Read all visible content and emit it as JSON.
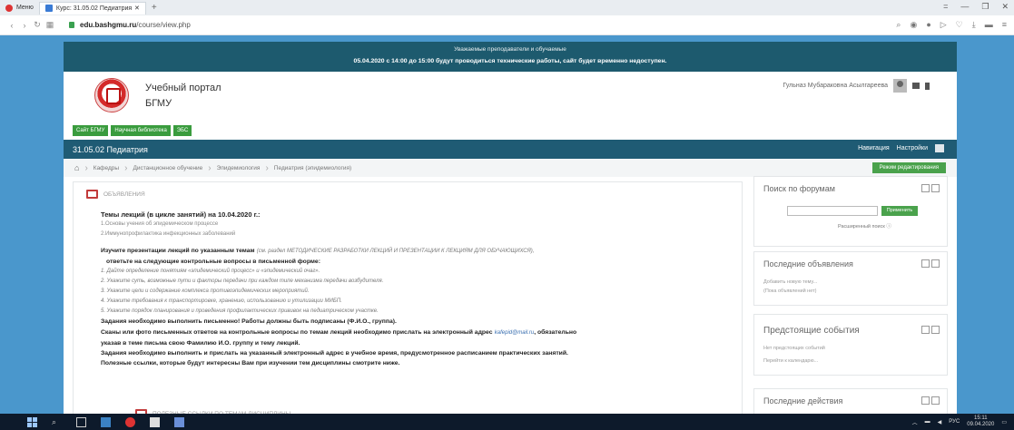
{
  "browser": {
    "tabs": [
      {
        "label": "Меню"
      },
      {
        "label": "Курс: 31.05.02 Педиатрия"
      }
    ],
    "new_tab": "+",
    "url_domain": "edu.bashgmu.ru",
    "url_path": "/course/view.php",
    "window_controls": [
      "=",
      "—",
      "❐",
      "✕"
    ]
  },
  "notice": {
    "line1": "Уважаемые преподаватели и обучаемые",
    "line2": "05.04.2020 с 14:00 до 15:00 будут проводиться технические работы, сайт будет временно недоступен."
  },
  "brand": {
    "title_line1": "Учебный портал",
    "title_line2": "БГМУ"
  },
  "user": {
    "name": "Гульназ Мубараковна Асылгареева"
  },
  "quick_links": [
    "Сайт БГМУ",
    "Научная библиотека",
    "ЭБС"
  ],
  "course_bar": {
    "title": "31.05.02 Педиатрия",
    "navigation": "Навигация",
    "settings": "Настройки"
  },
  "breadcrumbs": [
    "Кафедры",
    "Дистанционное обучение",
    "Эпидемиология",
    "Педиатрия (эпидемиология)"
  ],
  "edit_button": "Режим редактирования",
  "announcements": {
    "header": "ОБЪЯВЛЕНИЯ",
    "title": "Темы лекций (в цикле занятий) на 10.04.2020 г.:",
    "topic1": "1.Основы учения об эпидемическом процессе",
    "topic2": "2.Иммунопрофилактика инфекционных заболеваний",
    "instr1": "Изучите презентации лекций по указанным темам",
    "instr1_italic": "(см. раздел МЕТОДИЧЕСКИЕ РАЗРАБОТКИ ЛЕКЦИЙ И ПРЕЗЕНТАЦИИ К ЛЕКЦИЯМ ДЛЯ ОБУЧАЮЩИХСЯ),",
    "instr2": "ответьте на следующие контрольные вопросы в письменной форме:",
    "questions": [
      "1. Дайте определение понятиям «эпидемический процесс» и «эпидемический очаг».",
      "2. Укажите суть, возможные пути и факторы передачи при каждом типе механизма передачи возбудителя.",
      "3. Укажите цели и содержание комплекса противоэпидемических мероприятий.",
      "4. Укажите требования к транспортировке, хранению, использованию и утилизации МИБП.",
      "5. Укажите порядок планирования и проведения профилактических прививок на педиатрическом участке."
    ],
    "task": "Задания необходимо выполнить письменно! Работы должны быть подписаны (Ф.И.О., группа).",
    "send1": "Сканы или фото письменных ответов на контрольные вопросы по темам лекций необходимо прислать на электронный адрес",
    "email": "kafepid@mail.ru",
    "send1b": ", обязательно",
    "send2": "указав в теме письма свою Фамилию И.О. группу и тему лекций.",
    "send3": "Задания необходимо выполнить и прислать на указанный электронный адрес в учебное время, предусмотренное расписанием практических занятий.",
    "send4": "Полезные ссылки, которые будут интересны Вам при изучении тем дисциплины смотрите ниже.",
    "links_header": "ПОЛЕЗНЫЕ ССЫЛКИ ПО ТЕМАМ ДИСЦИПЛИНЫ"
  },
  "sidebar": {
    "forum_search": {
      "title": "Поиск по форумам",
      "apply": "Применить",
      "advanced": "Расширенный поиск"
    },
    "latest_news": {
      "title": "Последние объявления",
      "add": "Добавить новую тему...",
      "none": "(Пока объявлений нет)"
    },
    "upcoming": {
      "title": "Предстоящие события",
      "none": "Нет предстоящих событий",
      "goto": "Перейти к календарю..."
    },
    "recent": {
      "title": "Последние действия"
    }
  },
  "taskbar": {
    "lang": "РУС",
    "time": "15:11",
    "date": "09.04.2020"
  }
}
